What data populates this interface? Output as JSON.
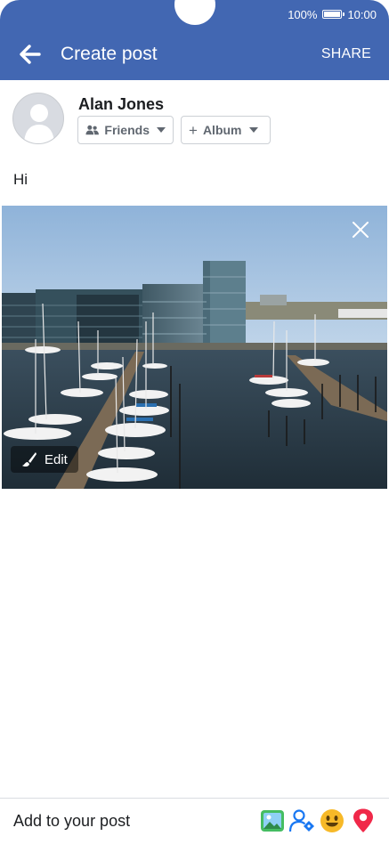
{
  "status_bar": {
    "battery_text": "100%",
    "time": "10:00"
  },
  "app_bar": {
    "title": "Create post",
    "share_label": "SHARE"
  },
  "author": {
    "name": "Alan Jones"
  },
  "audience": {
    "privacy_label": "Friends",
    "album_label": "Album"
  },
  "post": {
    "text": "Hi"
  },
  "photo": {
    "edit_label": "Edit"
  },
  "bottom_bar": {
    "label": "Add to your post",
    "tools": [
      "photo-icon",
      "tag-people-icon",
      "feeling-icon",
      "check-in-icon"
    ]
  },
  "colors": {
    "header": "#4267b2",
    "text": "#1c1e21",
    "secondary_text": "#606770"
  }
}
